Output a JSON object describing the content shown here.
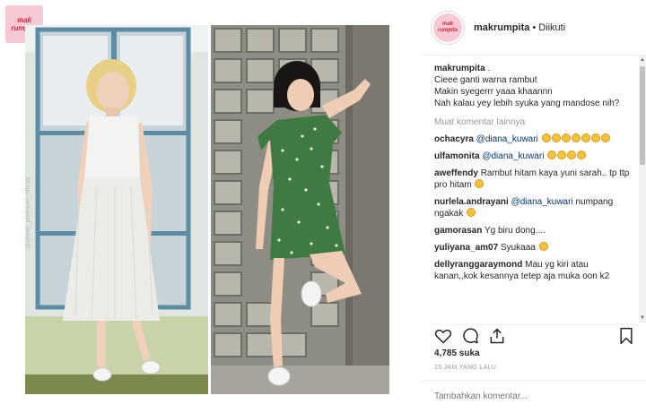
{
  "logo": {
    "text": "mak rumpita"
  },
  "watermark": "@shoes_premium_official",
  "post": {
    "username": "makrumpita",
    "separator": "•",
    "follow_status": "Diikuti",
    "caption": {
      "username": "makrumpita",
      "lines": [
        "Cieee ganti warna rambut",
        "Makin syegerrr yaaa khaannn",
        "Nah kalau yey lebih syuka yang mandose nih?"
      ],
      "first_suffix": "."
    },
    "more_comments_label": "Muat komentar lainnya",
    "comments": [
      {
        "user": "ochacyra",
        "mention": "@diana_kuwari",
        "text": "",
        "emoji_count": 7
      },
      {
        "user": "ulfamonita",
        "mention": "@diana_kuwari",
        "text": "",
        "emoji_count": 4
      },
      {
        "user": "aweffendy",
        "mention": "",
        "text": "Rambut hitam kaya yuni sarah.. tp ttp pro hitam",
        "emoji_count": 1
      },
      {
        "user": "nurlela.andrayani",
        "mention": "@diana_kuwari",
        "text": "numpang ngakak",
        "emoji_count": 1
      },
      {
        "user": "gamorasan",
        "mention": "",
        "text": "Yg biru dong....",
        "emoji_count": 0
      },
      {
        "user": "yuliyana_am07",
        "mention": "",
        "text": "Syukaaa",
        "emoji_count": 1
      },
      {
        "user": "dellyranggaraymond",
        "mention": "",
        "text": "Mau yg kiri atau kanan,,kok kesannya tetep aja muka oon k2",
        "emoji_count": 0
      }
    ],
    "likes": "4,785 suka",
    "timestamp": "15 JAM YANG LALU",
    "add_comment_placeholder": "Tambahkan komentar..."
  },
  "colors": {
    "mention": "#003569",
    "muted": "#999999",
    "emoji": "#f5c33b",
    "green_dress": "#3f7a43"
  }
}
